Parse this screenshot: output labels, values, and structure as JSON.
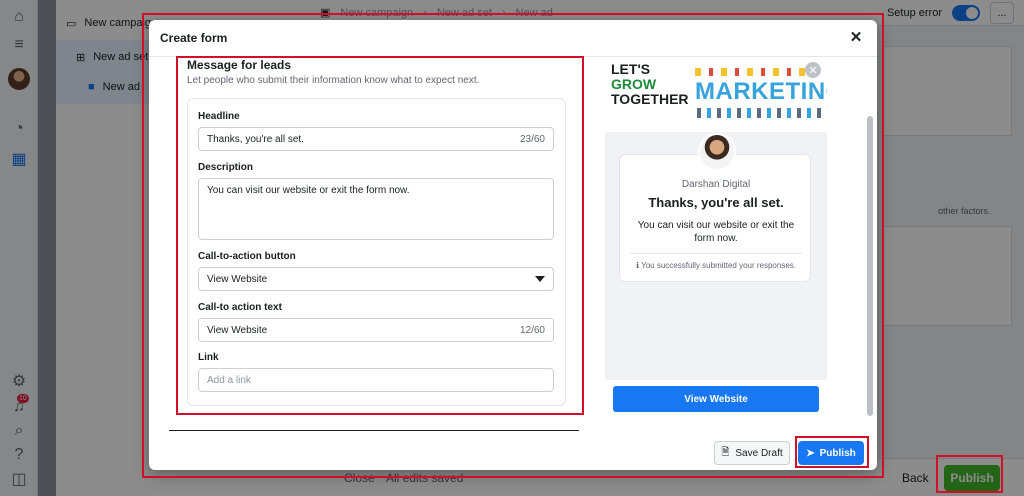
{
  "tree": {
    "campaign": "New campaign",
    "adset": "New ad set",
    "ad": "New ad"
  },
  "topbar": {
    "crumb_campaign": "New campaign",
    "crumb_adset": "New ad set",
    "crumb_ad": "New ad",
    "setup_error": "Setup error",
    "more": "..."
  },
  "background": {
    "other_factors": "other factors.",
    "close_label": "Close",
    "saved_label": "All edits saved",
    "back_label": "Back",
    "publish_label": "Publish"
  },
  "rail": {
    "notification_count": "10"
  },
  "modal": {
    "title": "Create form",
    "close_glyph": "✕"
  },
  "form": {
    "section_title": "Message for leads",
    "section_subtitle": "Let people who submit their information know what to expect next.",
    "headline_label": "Headline",
    "headline_value": "Thanks, you're all set.",
    "headline_count": "23/60",
    "description_label": "Description",
    "description_value": "You can visit our website or exit the form now.",
    "cta_button_label": "Call-to-action button",
    "cta_button_value": "View Website",
    "cta_text_label": "Call-to action text",
    "cta_text_value": "View Website",
    "cta_text_count": "12/60",
    "link_label": "Link",
    "link_placeholder": "Add a link"
  },
  "preview": {
    "banner_lets": "LET'S",
    "banner_grow": "GROW",
    "banner_together": "TOGETHER",
    "banner_marketing": "MARKETING",
    "page_name": "Darshan Digital",
    "headline": "Thanks, you're all set.",
    "description": "You can visit our website or exit the form now.",
    "footer_note": "You successfully submitted your responses.",
    "button": "View Website"
  },
  "footer": {
    "save_draft": "Save Draft",
    "publish": "Publish"
  },
  "colors": {
    "accent_blue": "#1877f2",
    "publish_green": "#42b72a",
    "annotation_red": "#d0102a"
  }
}
